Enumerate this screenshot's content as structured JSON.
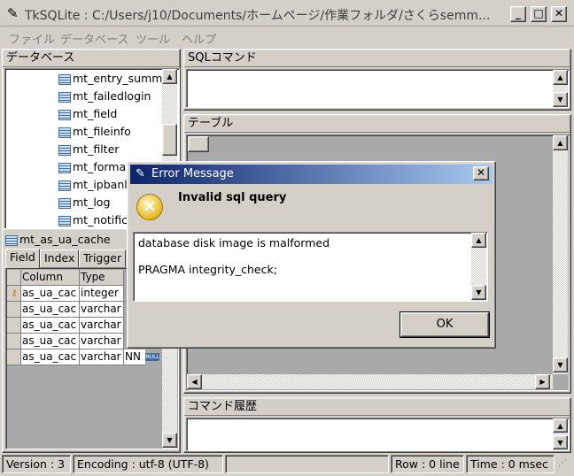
{
  "window": {
    "title": "TkSQLite : C:/Users/j10/Documents/ホームページ/作業フォルダ/さくらsemm...",
    "min": "_",
    "max": "□",
    "close": "✕"
  },
  "menu": {
    "items": [
      "ファイル",
      "データベース",
      "ツール",
      "ヘルプ"
    ]
  },
  "database_panel": {
    "title": "データベース",
    "tree": [
      "mt_entry_summ",
      "mt_failedlogin",
      "mt_field",
      "mt_fileinfo",
      "mt_filter",
      "mt_format",
      "mt_ipbanli",
      "mt_log",
      "mt_notific"
    ]
  },
  "table_panel": {
    "name": "mt_as_ua_cache",
    "tabs": [
      "Field",
      "Index",
      "Trigger"
    ],
    "columns": [
      "",
      "Column",
      "Type"
    ],
    "rows": [
      {
        "name": "as_ua_cac",
        "type": "integer",
        "extra": "",
        "key": true
      },
      {
        "name": "as_ua_cac",
        "type": "varchar",
        "extra": "",
        "key": false
      },
      {
        "name": "as_ua_cac",
        "type": "varchar",
        "extra": "",
        "key": false
      },
      {
        "name": "as_ua_cac",
        "type": "varchar",
        "extra": "",
        "key": false
      },
      {
        "name": "as_ua_cac",
        "type": "varchar",
        "extra": "NN",
        "key": false
      }
    ],
    "null_badge": "NULL"
  },
  "sql_panel": {
    "title": "SQLコマンド"
  },
  "table_view": {
    "title": "テーブル"
  },
  "history_panel": {
    "title": "コマンド履歴"
  },
  "dialog": {
    "title": "Error Message",
    "close": "✕",
    "message": "Invalid sql query",
    "detail_line1": "database disk image is malformed",
    "detail_line2": "PRAGMA integrity_check;",
    "ok": "OK"
  },
  "status": {
    "version": "Version : 3",
    "encoding": "Encoding : utf-8 (UTF-8)",
    "row": "Row : 0 line",
    "time": "Time : 0 msec"
  }
}
